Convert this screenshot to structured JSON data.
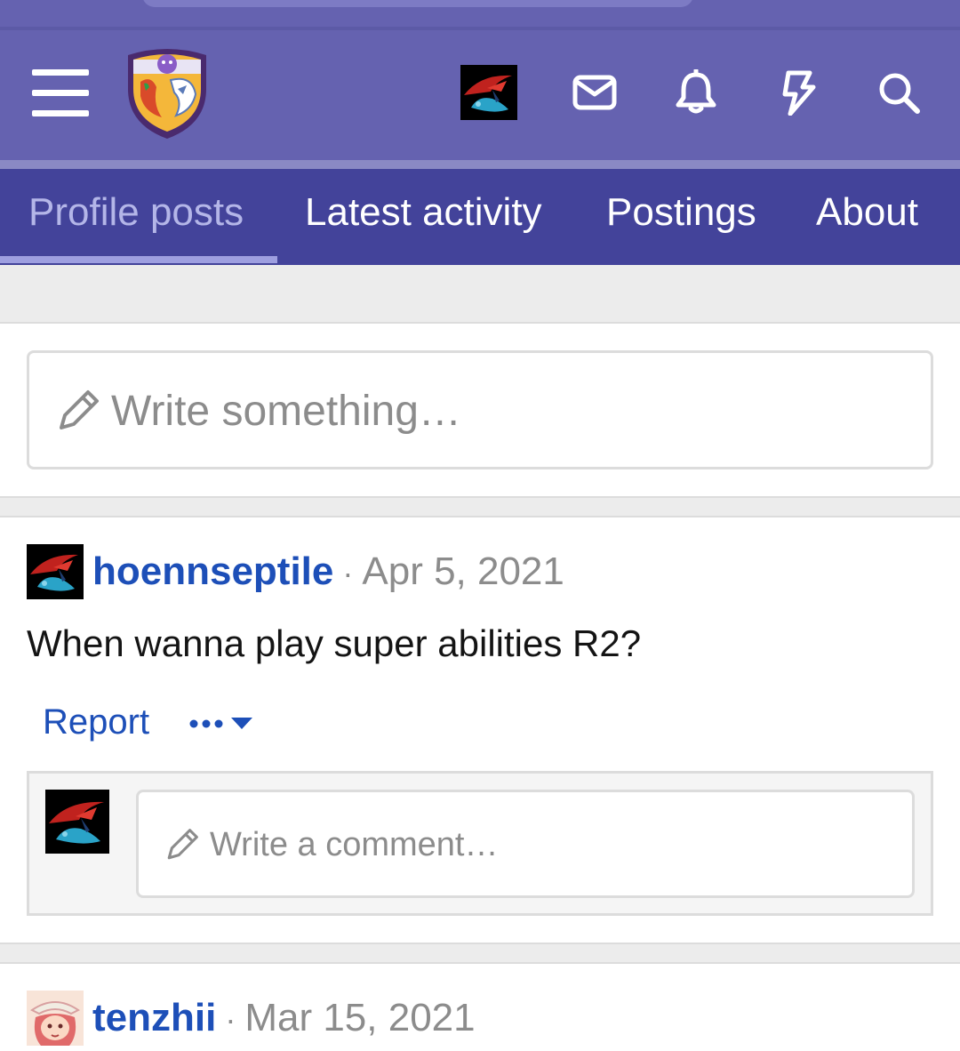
{
  "colors": {
    "header_bg": "#6562b0",
    "tabs_bg": "#43439a",
    "link": "#1d4fb8",
    "muted": "#8c8c8c"
  },
  "header": {
    "icons": [
      "menu-icon",
      "forum-logo",
      "user-avatar",
      "mail-icon",
      "bell-icon",
      "lightning-icon",
      "search-icon"
    ]
  },
  "tabs": [
    {
      "label": "Profile posts",
      "active": true
    },
    {
      "label": "Latest activity",
      "active": false
    },
    {
      "label": "Postings",
      "active": false
    },
    {
      "label": "About",
      "active": false
    }
  ],
  "composer": {
    "placeholder": "Write something…"
  },
  "posts": [
    {
      "username": "hoennseptile",
      "separator": "·",
      "date": "Apr 5, 2021",
      "body": "When wanna play super abilities R2?",
      "report_label": "Report",
      "more_label": "•••",
      "comment_placeholder": "Write a comment…"
    },
    {
      "username": "tenzhii",
      "separator": "·",
      "date": "Mar 15, 2021"
    }
  ]
}
